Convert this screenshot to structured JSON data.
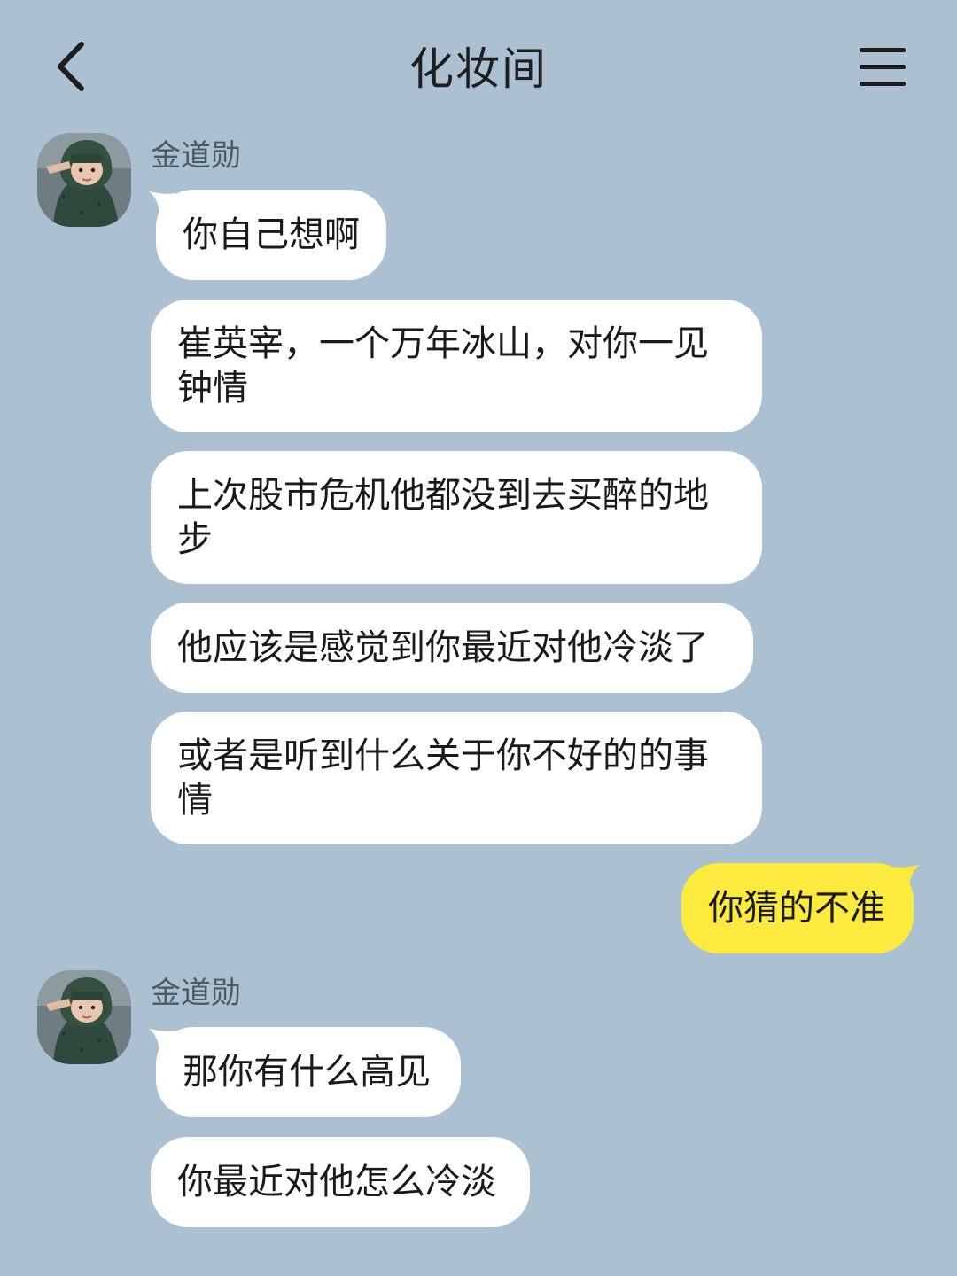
{
  "header": {
    "back_icon": "chevron-left-icon",
    "title": "化妆间",
    "menu_icon": "hamburger-menu-icon"
  },
  "colors": {
    "background": "#abc1d2",
    "incoming_bubble": "#ffffff",
    "outgoing_bubble": "#fdea3e"
  },
  "groups": [
    {
      "sender": "金道勋",
      "messages": [
        "你自己想啊",
        "崔英宰，一个万年冰山，对你一见钟情",
        "上次股市危机他都没到去买醉的地步",
        "他应该是感觉到你最近对他冷淡了",
        "或者是听到什么关于你不好的的事情"
      ]
    },
    {
      "outgoing": "你猜的不准"
    },
    {
      "sender": "金道勋",
      "messages": [
        "那你有什么高见",
        "你最近对他怎么冷淡"
      ]
    }
  ]
}
